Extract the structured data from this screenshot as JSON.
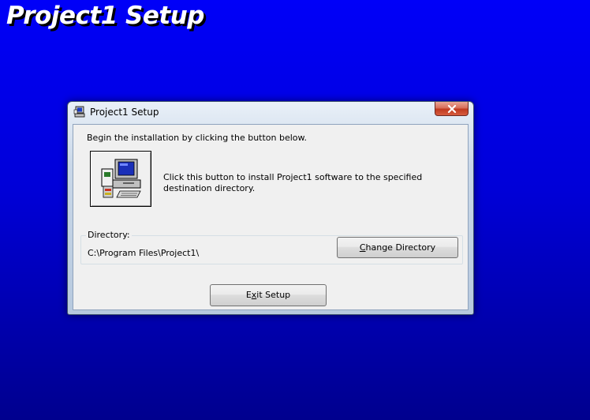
{
  "background": {
    "banner_title": "Project1 Setup",
    "colors": {
      "top": "#0000f8",
      "bottom": "#00008e"
    }
  },
  "dialog": {
    "title": "Project1 Setup",
    "title_icon": "setup-computer-icon",
    "close_icon": "close-icon",
    "intro_text": "Begin the installation by clicking the button below.",
    "install_button": {
      "icon": "setup-computer-icon",
      "description": "Click this button to install Project1 software to the specified destination directory."
    },
    "directory": {
      "label": "Directory:",
      "path": "C:\\Program Files\\Project1\\"
    },
    "change_directory_button": {
      "accel": "C",
      "rest": "hange Directory"
    },
    "exit_button": {
      "before": "E",
      "accel": "x",
      "rest": "it Setup"
    }
  }
}
